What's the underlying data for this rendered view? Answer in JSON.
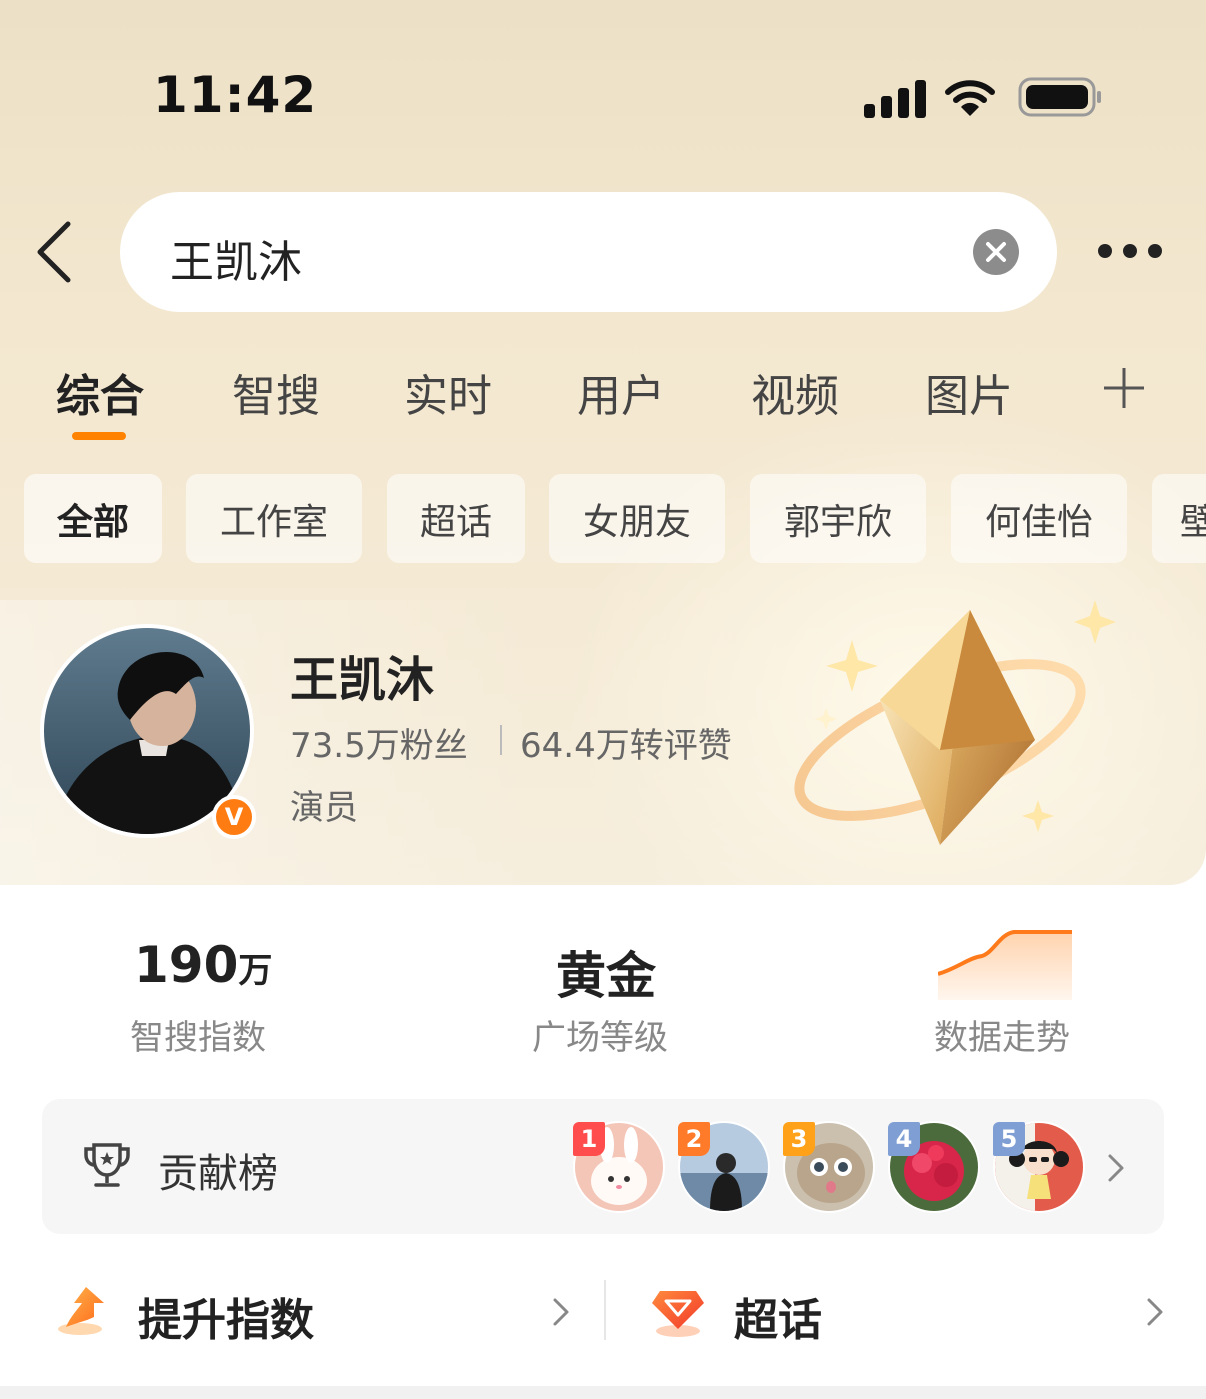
{
  "status_bar": {
    "time": "11:42"
  },
  "search": {
    "query": "王凯沐"
  },
  "tabs": [
    {
      "label": "综合"
    },
    {
      "label": "智搜"
    },
    {
      "label": "实时"
    },
    {
      "label": "用户"
    },
    {
      "label": "视频"
    },
    {
      "label": "图片"
    }
  ],
  "chips": [
    {
      "label": "全部"
    },
    {
      "label": "工作室"
    },
    {
      "label": "超话"
    },
    {
      "label": "女朋友"
    },
    {
      "label": "郭宇欣"
    },
    {
      "label": "何佳怡"
    },
    {
      "label": "壁"
    }
  ],
  "profile": {
    "name": "王凯沐",
    "fans": "73.5万粉丝",
    "interactions": "64.4万转评赞",
    "role": "演员",
    "verified_badge": "V"
  },
  "metrics": {
    "index_value": "190",
    "index_unit": "万",
    "index_label": "智搜指数",
    "level_value": "黄金",
    "level_label": "广场等级",
    "trend_label": "数据走势"
  },
  "contribution": {
    "label": "贡献榜",
    "ranks": [
      "1",
      "2",
      "3",
      "4",
      "5"
    ]
  },
  "bottom": {
    "boost_label": "提升指数",
    "topic_label": "超话"
  },
  "colors": {
    "accent": "#ff8200",
    "rank1": "#ff4d4d",
    "rank2": "#ff7a29",
    "rank3": "#ffa21a",
    "rank4": "#7f9fd4",
    "rank5": "#7f9fd4"
  }
}
